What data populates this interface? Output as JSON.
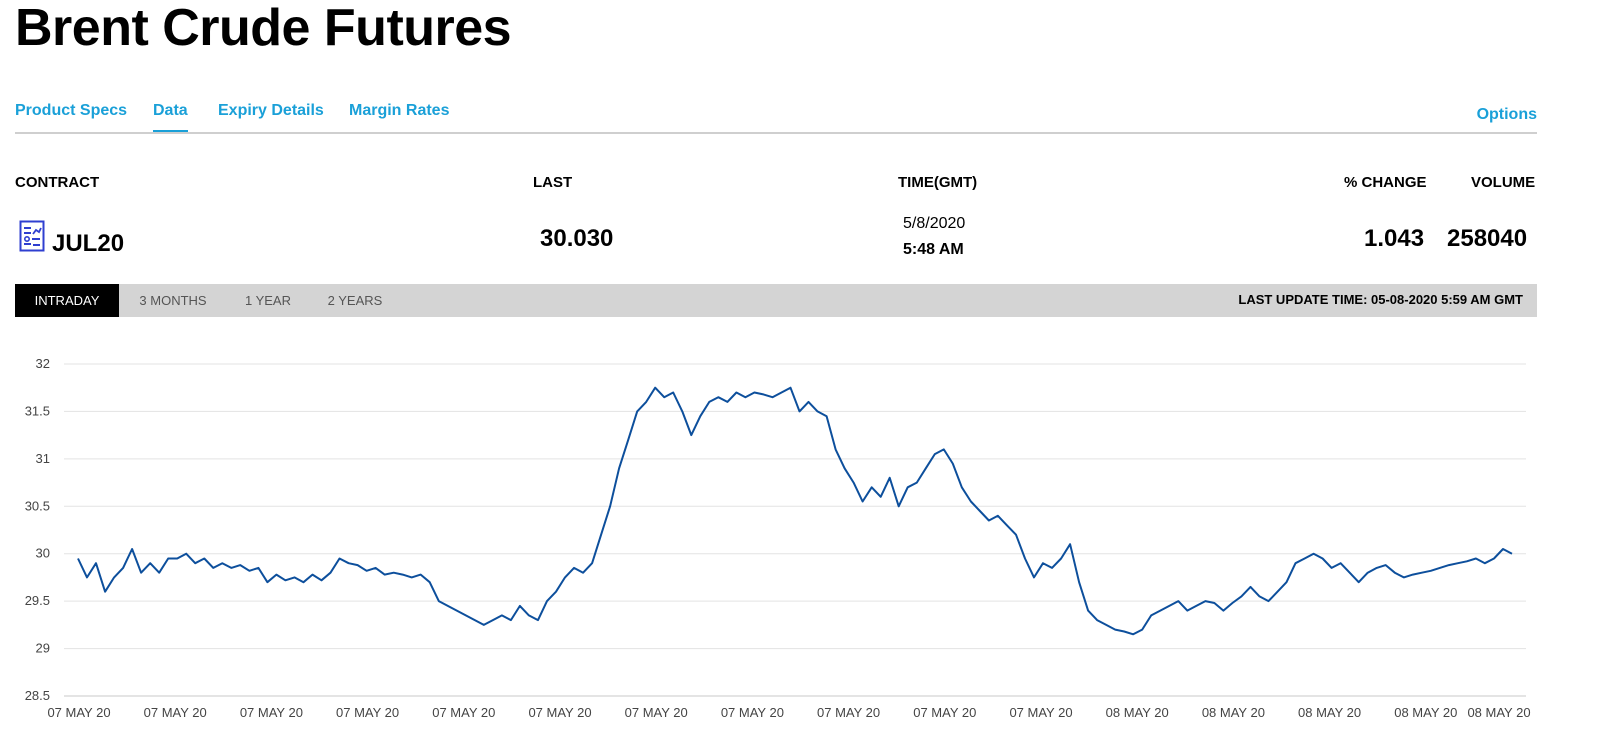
{
  "page": {
    "title": "Brent Crude Futures"
  },
  "tabs": [
    {
      "label": "Product Specs",
      "active": false
    },
    {
      "label": "Data",
      "active": true
    },
    {
      "label": "Expiry Details",
      "active": false
    },
    {
      "label": "Margin Rates",
      "active": false
    }
  ],
  "tab_right": {
    "label": "Options"
  },
  "table": {
    "headers": {
      "contract": "CONTRACT",
      "last": "LAST",
      "time": "TIME(GMT)",
      "pct_change": "% CHANGE",
      "volume": "VOLUME"
    },
    "row": {
      "contract": "JUL20",
      "last": "30.030",
      "date": "5/8/2020",
      "time": "5:48 AM",
      "pct_change": "1.043",
      "volume": "258040"
    },
    "contract_icon": "report-icon"
  },
  "ranges": [
    {
      "label": "INTRADAY",
      "active": true
    },
    {
      "label": "3 MONTHS",
      "active": false
    },
    {
      "label": "1 YEAR",
      "active": false
    },
    {
      "label": "2 YEARS",
      "active": false
    }
  ],
  "last_update": "LAST UPDATE TIME: 05-08-2020 5:59 AM GMT",
  "colors": {
    "line": "#0d4f9c",
    "accent": "#1aa0d8",
    "grid": "#e3e3e3",
    "range_bar": "#d4d4d4"
  },
  "chart_data": {
    "type": "line",
    "ylim": [
      28.5,
      32
    ],
    "yticks": [
      28.5,
      29,
      29.5,
      30,
      30.5,
      31,
      31.5,
      32
    ],
    "ytick_labels": [
      "28.5",
      "29",
      "29.5",
      "30",
      "30.5",
      "31",
      "31.5",
      "32"
    ],
    "xtick_labels": [
      "07 MAY 20",
      "07 MAY 20",
      "07 MAY 20",
      "07 MAY 20",
      "07 MAY 20",
      "07 MAY 20",
      "07 MAY 20",
      "07 MAY 20",
      "07 MAY 20",
      "07 MAY 20",
      "07 MAY 20",
      "08 MAY 20",
      "08 MAY 20",
      "08 MAY 20",
      "08 MAY 20",
      "08 MAY 20"
    ],
    "grid": true,
    "series": [
      {
        "values": [
          29.95,
          29.75,
          29.9,
          29.6,
          29.75,
          29.85,
          30.05,
          29.8,
          29.9,
          29.8,
          29.95,
          29.95,
          30.0,
          29.9,
          29.95,
          29.85,
          29.9,
          29.85,
          29.88,
          29.82,
          29.85,
          29.7,
          29.78,
          29.72,
          29.75,
          29.7,
          29.78,
          29.72,
          29.8,
          29.95,
          29.9,
          29.88,
          29.82,
          29.85,
          29.78,
          29.8,
          29.78,
          29.75,
          29.78,
          29.7,
          29.5,
          29.45,
          29.4,
          29.35,
          29.3,
          29.25,
          29.3,
          29.35,
          29.3,
          29.45,
          29.35,
          29.3,
          29.5,
          29.6,
          29.75,
          29.85,
          29.8,
          29.9,
          30.2,
          30.5,
          30.9,
          31.2,
          31.5,
          31.6,
          31.75,
          31.65,
          31.7,
          31.5,
          31.25,
          31.45,
          31.6,
          31.65,
          31.6,
          31.7,
          31.65,
          31.7,
          31.68,
          31.65,
          31.7,
          31.75,
          31.5,
          31.6,
          31.5,
          31.45,
          31.1,
          30.9,
          30.75,
          30.55,
          30.7,
          30.6,
          30.8,
          30.5,
          30.7,
          30.75,
          30.9,
          31.05,
          31.1,
          30.95,
          30.7,
          30.55,
          30.45,
          30.35,
          30.4,
          30.3,
          30.2,
          29.95,
          29.75,
          29.9,
          29.85,
          29.95,
          30.1,
          29.7,
          29.4,
          29.3,
          29.25,
          29.2,
          29.18,
          29.15,
          29.2,
          29.35,
          29.4,
          29.45,
          29.5,
          29.4,
          29.45,
          29.5,
          29.48,
          29.4,
          29.48,
          29.55,
          29.65,
          29.55,
          29.5,
          29.6,
          29.7,
          29.9,
          29.95,
          30.0,
          29.95,
          29.85,
          29.9,
          29.8,
          29.7,
          29.8,
          29.85,
          29.88,
          29.8,
          29.75,
          29.78,
          29.8,
          29.82,
          29.85,
          29.88,
          29.9,
          29.92,
          29.95,
          29.9,
          29.95,
          30.05,
          30.0
        ]
      }
    ]
  }
}
